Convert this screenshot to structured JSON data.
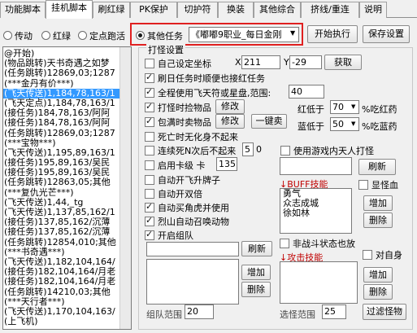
{
  "tabs": [
    {
      "label": "功能脚本"
    },
    {
      "label": "挂机脚本"
    },
    {
      "label": "刷红绿"
    },
    {
      "label": "PK保护"
    },
    {
      "label": "切护符"
    },
    {
      "label": "换装"
    },
    {
      "label": "其他综合"
    },
    {
      "label": "挤线/重连"
    },
    {
      "label": "说明"
    }
  ],
  "mode_radios": {
    "chuansong": "传动",
    "honglu": "红绿",
    "dingdian": "定点跑活",
    "qita": "其他任务"
  },
  "task_select_value": "《嘟嘟9职业_每日金刚",
  "buttons": {
    "start": "开始执行",
    "save": "保存设置",
    "fetch": "获取",
    "modify1": "修改",
    "modify2": "修改",
    "one_key_sell": "一键卖",
    "refresh_buff": "刷新",
    "add_buff": "增加",
    "del_buff": "删除",
    "refresh_team": "刷新",
    "add_team": "增加",
    "del_team": "删除",
    "filter_monsters": "过滤怪物"
  },
  "hang_settings_label": "打怪设置",
  "custom_coords": {
    "label": "自己设定坐标",
    "x_label": "X",
    "x_value": "211",
    "y_label": "Y",
    "y_value": "-29"
  },
  "options": {
    "brush_task": "刷日任务时顺便也接红任务",
    "fly_fullmap": "全程使用飞天符或星盘,范围:",
    "fly_range": "40",
    "pickup": "打怪时捡物品",
    "pack_sell": "包满时卖物品",
    "death_no_rise": "死亡时无化身不起来",
    "death_n": "连续死N次后不起来",
    "death_n_value": "5",
    "death_n_suffix": "0",
    "use_game_hang": "使用游戏内天人打怪",
    "auto_upgrade": "启用卡级 卡",
    "upgrade_level": "135",
    "auto_card": "自动开飞升牌子",
    "auto_return": "自动开双倍",
    "auto_buy_tiger": "自动买角虎并使用",
    "auto_summon": "烈山自动召唤动物",
    "auto_team": "开启组队",
    "show_value": "显怪血",
    "nonbattle_skill": "非战斗状态也放",
    "attack_self": "对自身"
  },
  "red_stone": {
    "label": "红低于",
    "value": "70",
    "suffix": "%吃红药"
  },
  "blue_stone": {
    "label": "蓝低于",
    "value": "50",
    "suffix": "%吃蓝药"
  },
  "buff_header": "↓BUFF技能",
  "buff_items": [
    "勇气",
    "众志成城",
    "徐如林"
  ],
  "attack_header": "↓攻击技能",
  "team_range": {
    "label": "组队范围",
    "value": "20"
  },
  "select_range": {
    "label": "选怪范围",
    "value": "25"
  },
  "script_lines": [
    "@开始)",
    "(物品跳转)天书奇遇之如梦",
    "(任务跳转)12869,03;1287",
    "(***金丹有价***)",
    "(飞天传送)1,184,78,163/1",
    "(飞天定点)1,184,78,163/1",
    "(接任务)184,78,163/阿阿",
    "(接任务)184,78,163/阿阿",
    "(任务跳转)12869,03;1287",
    "(***宝物***)",
    "(飞天传送)1,195,89,163/1",
    "(接任务)195,89,163/吴民",
    "(接任务)195,89,163/吴民",
    "(任务跳转)12863,05;其他",
    "(***复仇光芒***)",
    "(飞天传送)1,44,_tg",
    "(飞天传送)1,137,85,162/1",
    "(接任务)137,85,162/沉薄",
    "(接任务)137,85,162/沉薄",
    "(任务跳转)12854,010;其他",
    "(***书奇遇***)",
    "(飞天传送)1,182,104,164/",
    "(接任务)182,104,164/月老",
    "(接任务)182,104,164/月老",
    "(任务跳转)14210,03;其他",
    "(***天行者***)",
    "(飞天传送)1,170,104,163/",
    "(上飞机)"
  ],
  "selected_line_index": 4
}
